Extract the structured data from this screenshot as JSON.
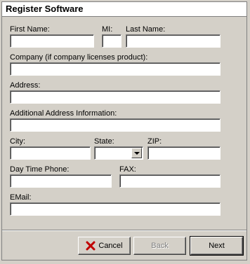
{
  "window": {
    "title": "Register Software"
  },
  "labels": {
    "first_name": "First Name:",
    "mi": "MI:",
    "last_name": "Last Name:",
    "company": "Company (if company licenses product):",
    "address": "Address:",
    "additional_address": "Additional Address Information:",
    "city": "City:",
    "state": "State:",
    "zip": "ZIP:",
    "day_phone": "Day Time Phone:",
    "fax": "FAX:",
    "email": "EMail:"
  },
  "fields": {
    "first_name": "",
    "mi": "",
    "last_name": "",
    "company": "",
    "address": "",
    "additional_address": "",
    "city": "",
    "state": "",
    "zip": "",
    "day_phone": "",
    "fax": "",
    "email": ""
  },
  "buttons": {
    "cancel": "Cancel",
    "back": "Back",
    "next": "Next"
  },
  "icons": {
    "cancel": "red-x-icon",
    "state_dropdown": "chevron-down-icon"
  },
  "colors": {
    "cancel_icon": "#c00000"
  }
}
